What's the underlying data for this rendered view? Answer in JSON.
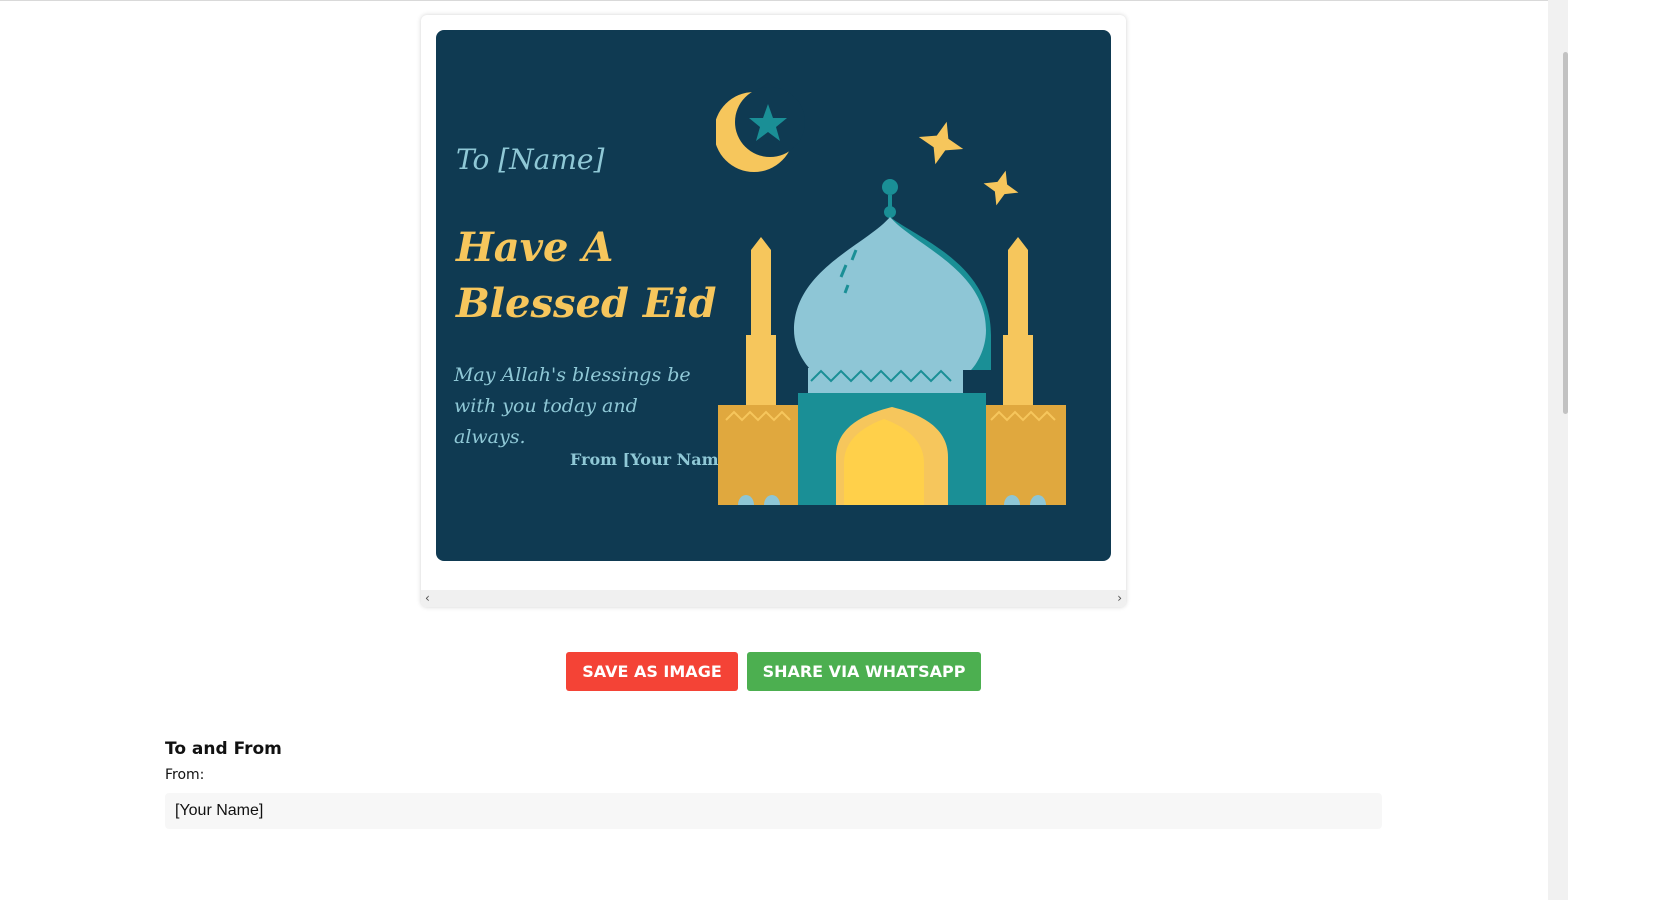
{
  "card": {
    "to_line": "To [Name]",
    "headline_line1": "Have A",
    "headline_line2": "Blessed Eid",
    "blessing": "May Allah's blessings be with you today and always.",
    "from_line": "From [Your Name]"
  },
  "scrollbar": {
    "left_arrow": "‹",
    "right_arrow": "›"
  },
  "actions": {
    "save_label": "SAVE AS IMAGE",
    "share_label": "SHARE VIA WHATSAPP"
  },
  "form": {
    "section_title": "To and From",
    "from_label": "From:",
    "from_value": "[Your Name]"
  },
  "colors": {
    "card_background": "#0f3a52",
    "headline": "#f6c65c",
    "accent_text": "#8fc8d6",
    "save_button": "#f44336",
    "share_button": "#4caf50"
  }
}
